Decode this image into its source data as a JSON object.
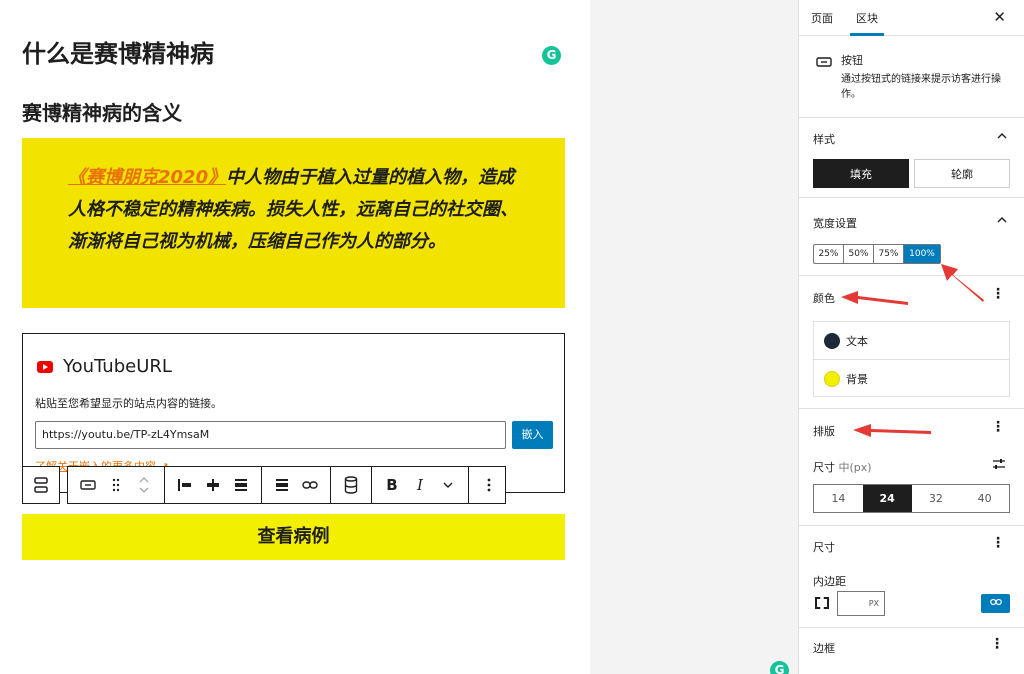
{
  "canvas": {
    "heading1": "什么是赛博精神病",
    "heading2": "赛博精神病的含义",
    "quote": {
      "link_text": "《赛博朋克2020》",
      "body_text": "中人物由于植入过量的植入物，造成人格不稳定的精神疾病。损失人性，远离自己的社交圈、渐渐将自己视为机械，压缩自己作为人的部分。"
    },
    "embed": {
      "title": "YouTubeURL",
      "instructions": "粘贴至您希望显示的站点内容的链接。",
      "input_value": "https://youtu.be/TP-zL4YmsaM",
      "button_label": "嵌入",
      "learn_more": "了解关于嵌入的更多内容 ↗"
    },
    "toolbar": {
      "bold_label": "B",
      "italic_label": "I"
    },
    "cta_label": "查看病例",
    "grammarly_label": "G"
  },
  "sidebar": {
    "tabs": [
      {
        "label": "页面",
        "active": false
      },
      {
        "label": "区块",
        "active": true
      }
    ],
    "close_label": "✕",
    "block": {
      "name": "按钮",
      "description": "通过按钮式的链接来提示访客进行操作。"
    },
    "styles": {
      "title": "样式",
      "options": [
        {
          "label": "填充",
          "selected": true
        },
        {
          "label": "轮廓",
          "selected": false
        }
      ]
    },
    "width": {
      "title": "宽度设置",
      "options": [
        {
          "label": "25%",
          "selected": false
        },
        {
          "label": "50%",
          "selected": false
        },
        {
          "label": "75%",
          "selected": false
        },
        {
          "label": "100%",
          "selected": true
        }
      ]
    },
    "color": {
      "title": "颜色",
      "items": [
        {
          "label": "文本",
          "swatch": "#1e2938"
        },
        {
          "label": "背景",
          "swatch": "#f2ef00"
        }
      ]
    },
    "typography": {
      "title": "排版",
      "size_label": "尺寸",
      "size_value": "中(px)",
      "sizes": [
        {
          "label": "14",
          "selected": false
        },
        {
          "label": "24",
          "selected": true
        },
        {
          "label": "32",
          "selected": false
        },
        {
          "label": "40",
          "selected": false
        }
      ]
    },
    "dimensions": {
      "title": "尺寸",
      "padding_label": "内边距",
      "padding_unit": "PX"
    },
    "border": {
      "title": "边框"
    }
  },
  "colors": {
    "accent": "#007cba",
    "quote_bg": "#f2e400",
    "cta_bg": "#f2ef00",
    "link": "#e8710a",
    "annotation_arrow": "#e53935"
  }
}
